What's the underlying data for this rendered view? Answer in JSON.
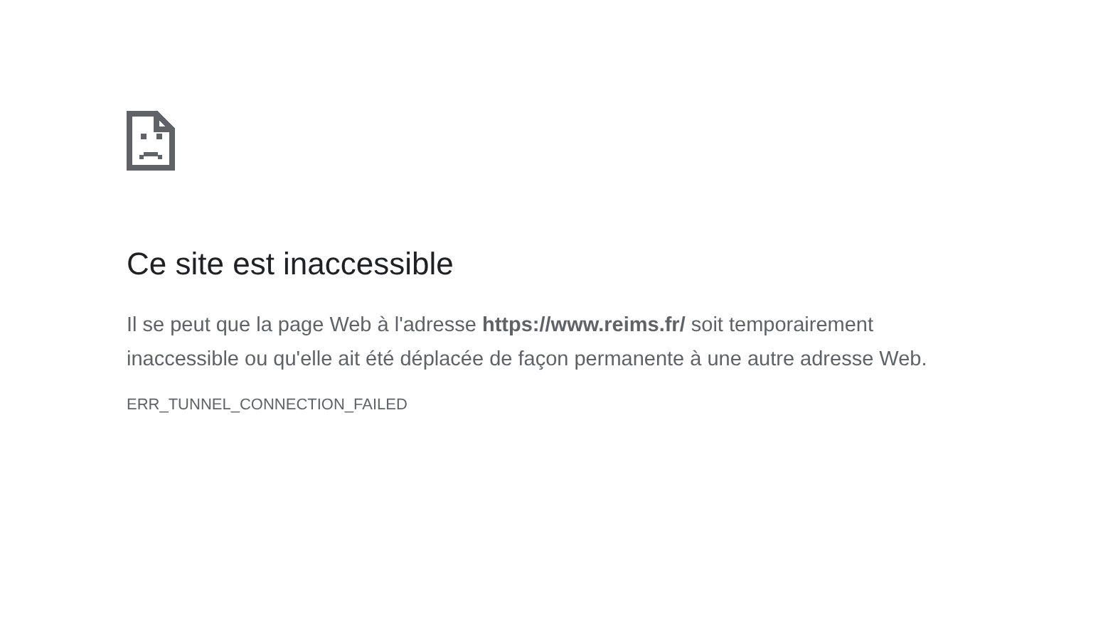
{
  "title": "Ce site est inaccessible",
  "message": "Il se peut que la page Web à l'adresse **https://www.reims.fr/** soit temporairement inaccessible ou qu'elle ait été déplacée de façon permanente à une autre adresse Web.",
  "error_code": "ERR_TUNNEL_CONNECTION_FAILED"
}
